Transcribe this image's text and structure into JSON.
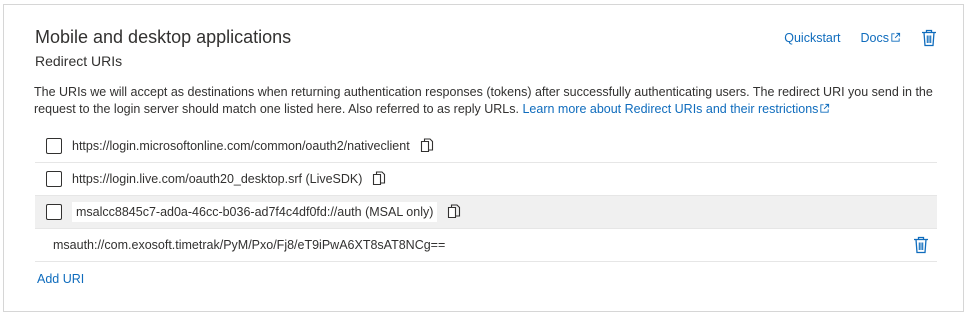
{
  "section": {
    "title": "Mobile and desktop applications",
    "subtitle": "Redirect URIs",
    "description": "The URIs we will accept as destinations when returning authentication responses (tokens) after successfully authenticating users. The redirect URI you send in the request to the login server should match one listed here. Also referred to as reply URLs.",
    "learn_more_link": "Learn more about Redirect URIs and their restrictions"
  },
  "actions": {
    "quickstart": "Quickstart",
    "docs": "Docs"
  },
  "uris": [
    {
      "value": "https://login.microsoftonline.com/common/oauth2/nativeclient",
      "checked": false
    },
    {
      "value": "https://login.live.com/oauth20_desktop.srf (LiveSDK)",
      "checked": false
    },
    {
      "value": "msalcc8845c7-ad0a-46cc-b036-ad7f4c4df0fd://auth (MSAL only)",
      "checked": false,
      "highlighted": true
    },
    {
      "value": "msauth://com.exosoft.timetrak/PyM/Pxo/Fj8/eT9iPwA6XT8sAT8NCg=="
    }
  ],
  "add_uri": "Add URI",
  "colors": {
    "link": "#0f6cbd",
    "text": "#323130",
    "row_highlight": "#f0f0f0"
  },
  "icons": {
    "delete": "trash-icon",
    "copy": "copy-icon",
    "external": "external-link-icon"
  }
}
